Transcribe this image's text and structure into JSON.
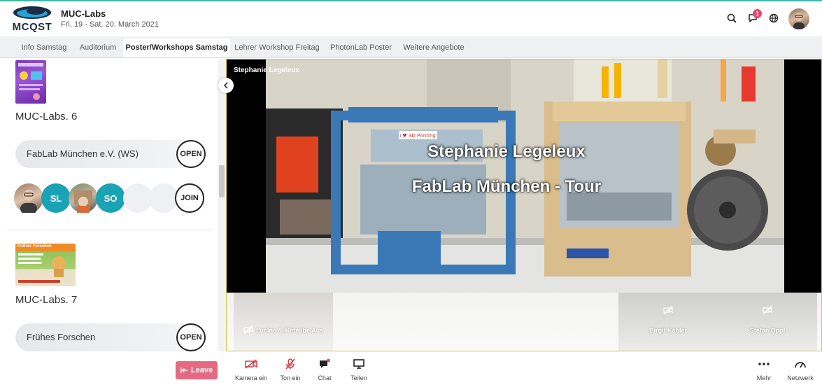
{
  "app": {
    "logo_text": "MCQST",
    "event_title": "MUC-Labs",
    "event_date": "Fri. 19 - Sat. 20. March 2021",
    "notification_count": "1"
  },
  "tabs": [
    {
      "label": "Info Samstag",
      "active": false
    },
    {
      "label": "Auditorium",
      "active": false
    },
    {
      "label": "Poster/Workshops Samstag",
      "active": true
    },
    {
      "label": "Lehrer Workshop Freitag",
      "active": false
    },
    {
      "label": "PhotonLab Poster",
      "active": false
    },
    {
      "label": "Weitere Angebote",
      "active": false
    }
  ],
  "sidebar": {
    "rooms": [
      {
        "title": "MUC-Labs. 6",
        "session_label": "FabLab München e.V. (WS)",
        "open_label": "OPEN",
        "join_label": "JOIN",
        "participants": [
          {
            "initials": "",
            "kind": "photo"
          },
          {
            "initials": "SL",
            "kind": "initials"
          },
          {
            "initials": "",
            "kind": "photo"
          },
          {
            "initials": "SO",
            "kind": "initials"
          },
          {
            "initials": "",
            "kind": "empty"
          },
          {
            "initials": "",
            "kind": "empty"
          }
        ]
      },
      {
        "title": "MUC-Labs. 7",
        "poster_title": "Frühes Forschen",
        "session_label": "Frühes Forschen",
        "open_label": "OPEN"
      }
    ]
  },
  "video": {
    "speaker_name": "Stephanie Legeleux",
    "overlay_line1": "Stephanie Legeleux",
    "overlay_line2": "FabLab München - Tour",
    "printer_sticker": "I ♥ 3D Printing",
    "tiles": [
      {
        "label": "Lucina & Mitteilbe Aus"
      },
      {
        "label": "Birgit Kahler"
      },
      {
        "label": "Stefan Oppl"
      }
    ]
  },
  "controls": {
    "leave_label": "Leave",
    "camera_label": "Kamera ein",
    "audio_label": "Ton ein",
    "chat_label": "Chat",
    "share_label": "Teilen",
    "more_label": "Mehr",
    "network_label": "Netzwerk"
  },
  "colors": {
    "accent_teal": "#1aa3b5",
    "leave": "#e46a82",
    "mute_red": "#d9363e",
    "badge": "#e34a6f"
  }
}
